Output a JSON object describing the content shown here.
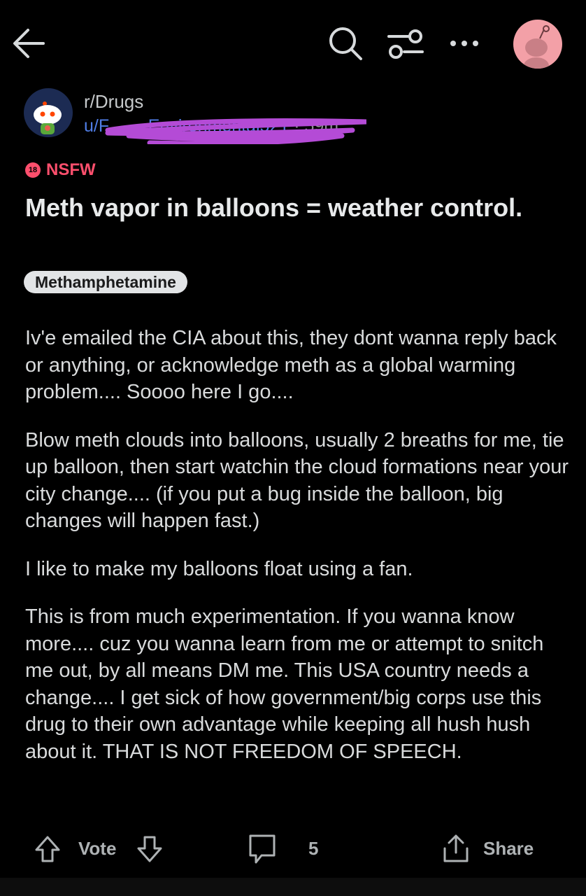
{
  "header": {
    "icons": [
      "back-arrow-icon",
      "search-icon",
      "filter-icon",
      "more-icon",
      "user-avatar"
    ]
  },
  "post": {
    "subreddit": "r/Drugs",
    "username": "u/F____Environmental521",
    "time": "· 59m",
    "nsfw_badge": "18",
    "nsfw_label": "NSFW",
    "title": "Meth vapor in balloons = weather control.",
    "flair": "Methamphetamine",
    "paragraphs": [
      "Iv'e emailed the CIA about this, they dont wanna reply back or anything, or acknowledge meth as a global warming problem.... Soooo here I go....",
      "Blow meth clouds into balloons, usually 2 breaths for me, tie up balloon, then start watchin the cloud formations near your city change.... (if you put a bug inside the balloon, big changes will happen fast.)",
      "I like to make my balloons float using a fan.",
      "This is from much experimentation.  If you wanna know more.... cuz you wanna learn from me or attempt to snitch me out, by all means DM me.  This USA country needs a change.... I get sick of how government/big corps use this drug to their own advantage while keeping all hush hush about it. THAT IS NOT FREEDOM OF SPEECH."
    ]
  },
  "actions": {
    "vote_label": "Vote",
    "comment_count": "5",
    "share_label": "Share"
  },
  "colors": {
    "background": "#000000",
    "nsfw": "#ff4f6d",
    "username": "#4f7de6",
    "scribble": "#b44bd6",
    "flair_bg": "#e2e4e6"
  }
}
